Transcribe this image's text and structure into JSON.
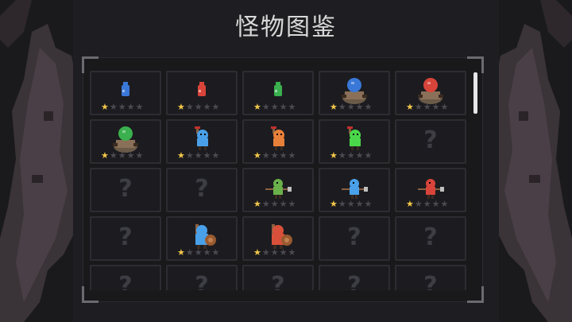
{
  "title": "怪物图鉴",
  "colors": {
    "star_on": "#f2c74a",
    "star_off": "#4a4a50",
    "unknown": "#3d3d44"
  },
  "cells": [
    {
      "monster": "blue-potion-slime",
      "discovered": true,
      "stars": 1,
      "color": "#3a78d8"
    },
    {
      "monster": "red-potion-slime",
      "discovered": true,
      "stars": 1,
      "color": "#d8443a"
    },
    {
      "monster": "green-potion-slime",
      "discovered": true,
      "stars": 1,
      "color": "#3ab04e"
    },
    {
      "monster": "blue-potion-cauldron",
      "discovered": true,
      "stars": 1,
      "color": "#3a78d8"
    },
    {
      "monster": "red-potion-cauldron",
      "discovered": true,
      "stars": 1,
      "color": "#d8443a"
    },
    {
      "monster": "green-potion-cauldron",
      "discovered": true,
      "stars": 1,
      "color": "#3ab04e"
    },
    {
      "monster": "blue-goblin",
      "discovered": true,
      "stars": 1,
      "color": "#4aa0e8"
    },
    {
      "monster": "orange-goblin",
      "discovered": true,
      "stars": 1,
      "color": "#e8803a"
    },
    {
      "monster": "green-goblin",
      "discovered": true,
      "stars": 1,
      "color": "#4ad84a"
    },
    {
      "monster": "unknown",
      "discovered": false,
      "label": "?"
    },
    {
      "monster": "unknown",
      "discovered": false,
      "label": "?"
    },
    {
      "monster": "unknown",
      "discovered": false,
      "label": "?"
    },
    {
      "monster": "green-spear-goblin",
      "discovered": true,
      "stars": 1,
      "color": "#6ab04a"
    },
    {
      "monster": "blue-spear-goblin",
      "discovered": true,
      "stars": 1,
      "color": "#4aa0e8"
    },
    {
      "monster": "red-spear-goblin",
      "discovered": true,
      "stars": 1,
      "color": "#d8443a"
    },
    {
      "monster": "unknown",
      "discovered": false,
      "label": "?"
    },
    {
      "monster": "blue-shield-brute",
      "discovered": true,
      "stars": 1,
      "color": "#4aa0e8"
    },
    {
      "monster": "red-shield-brute",
      "discovered": true,
      "stars": 1,
      "color": "#d8503a"
    },
    {
      "monster": "unknown",
      "discovered": false,
      "label": "?"
    },
    {
      "monster": "unknown",
      "discovered": false,
      "label": "?"
    },
    {
      "monster": "unknown",
      "discovered": false,
      "label": "?"
    },
    {
      "monster": "unknown",
      "discovered": false,
      "label": "?"
    },
    {
      "monster": "unknown",
      "discovered": false,
      "label": "?"
    },
    {
      "monster": "unknown",
      "discovered": false,
      "label": "?"
    },
    {
      "monster": "unknown",
      "discovered": false,
      "label": "?"
    }
  ],
  "max_stars": 5
}
